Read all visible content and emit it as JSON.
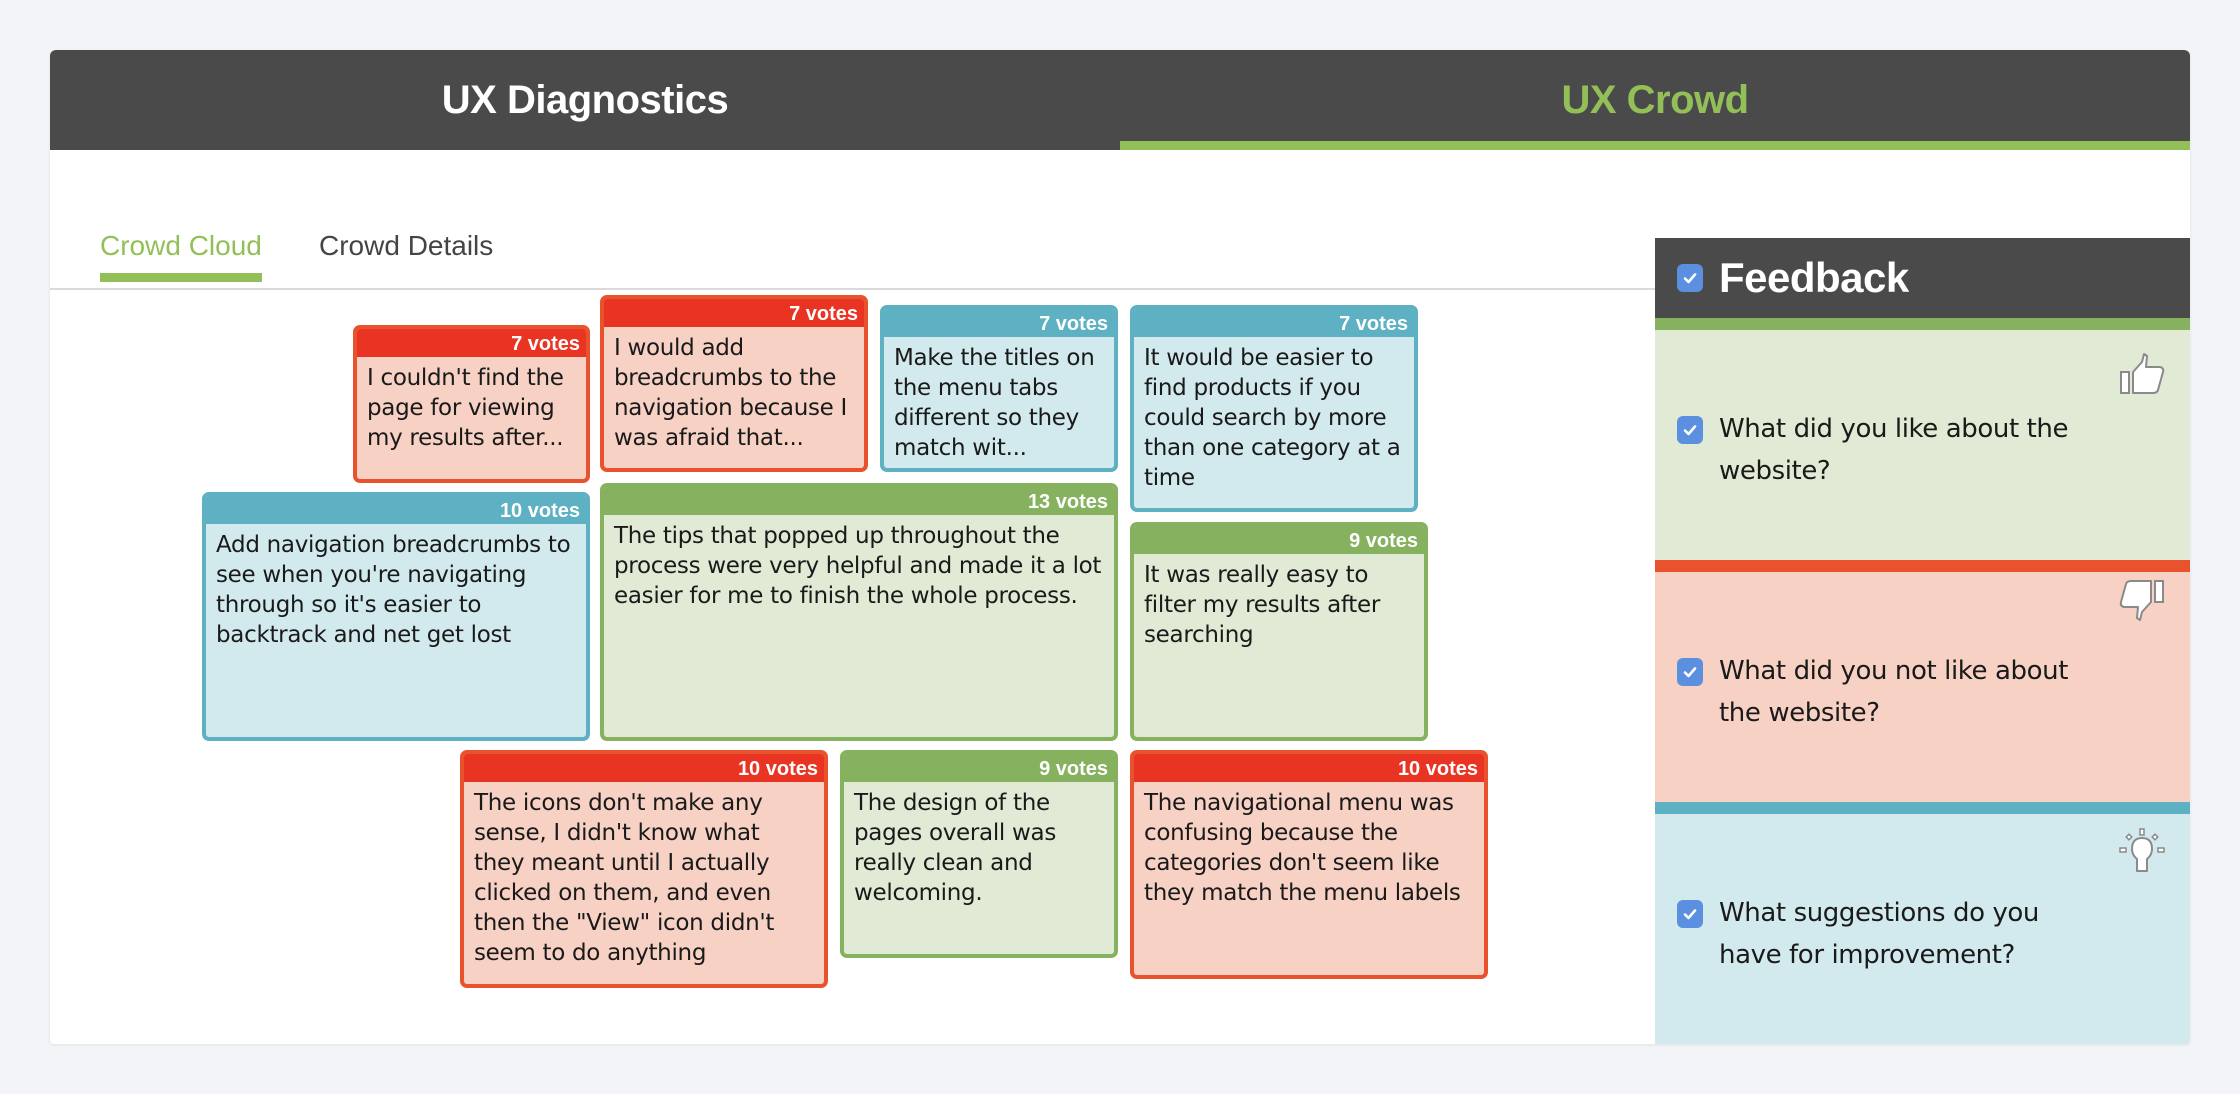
{
  "topnav": {
    "tabs": [
      {
        "label": "UX Diagnostics",
        "active": false
      },
      {
        "label": "UX Crowd",
        "active": true
      }
    ]
  },
  "subtabs": [
    {
      "label": "Crowd Cloud",
      "active": true
    },
    {
      "label": "Crowd Details",
      "active": false
    }
  ],
  "colors": {
    "accent_green": "#93bf58",
    "like": "#86b25f",
    "dislike": "#e93424",
    "suggest": "#5eb1c3",
    "header_dark": "#4a4a4a",
    "checkbox_blue": "#5b8fdf"
  },
  "cards": [
    {
      "category": "dislike",
      "votes": "7 votes",
      "text": "I couldn't find the page for viewing my results after..."
    },
    {
      "category": "dislike",
      "votes": "7 votes",
      "text": "I would add breadcrumbs to the navigation because I was afraid that..."
    },
    {
      "category": "suggest",
      "votes": "7 votes",
      "text": "Make the titles on the menu tabs different so they match wit..."
    },
    {
      "category": "suggest",
      "votes": "7 votes",
      "text": "It would be easier to find products if you could search by more than one category at a time"
    },
    {
      "category": "suggest",
      "votes": "10 votes",
      "text": "Add navigation breadcrumbs to see when you're navigating through so it's easier to backtrack and net get lost"
    },
    {
      "category": "like",
      "votes": "13 votes",
      "text": "The tips that popped up throughout the process were very helpful and made it a lot easier for me to finish the whole process."
    },
    {
      "category": "like",
      "votes": "9 votes",
      "text": "It was really easy to filter my results after searching"
    },
    {
      "category": "dislike",
      "votes": "10 votes",
      "text": "The icons don't make any sense, I didn't know what they meant until I actually clicked on them, and even then the \"View\" icon didn't seem to do anything"
    },
    {
      "category": "like",
      "votes": "9 votes",
      "text": "The design of the pages overall was really clean and welcoming."
    },
    {
      "category": "dislike",
      "votes": "10 votes",
      "text": "The navigational menu was confusing because the categories don't seem like they match the menu labels"
    }
  ],
  "feedback": {
    "title": "Feedback",
    "checked": true,
    "sections": [
      {
        "category": "like",
        "icon": "thumbs-up-icon",
        "question": "What did you like about the website?",
        "checked": true
      },
      {
        "category": "dislike",
        "icon": "thumbs-down-icon",
        "question": "What did you not like about the website?",
        "checked": true
      },
      {
        "category": "suggest",
        "icon": "lightbulb-icon",
        "question": "What suggestions do you have for improvement?",
        "checked": true
      }
    ]
  }
}
